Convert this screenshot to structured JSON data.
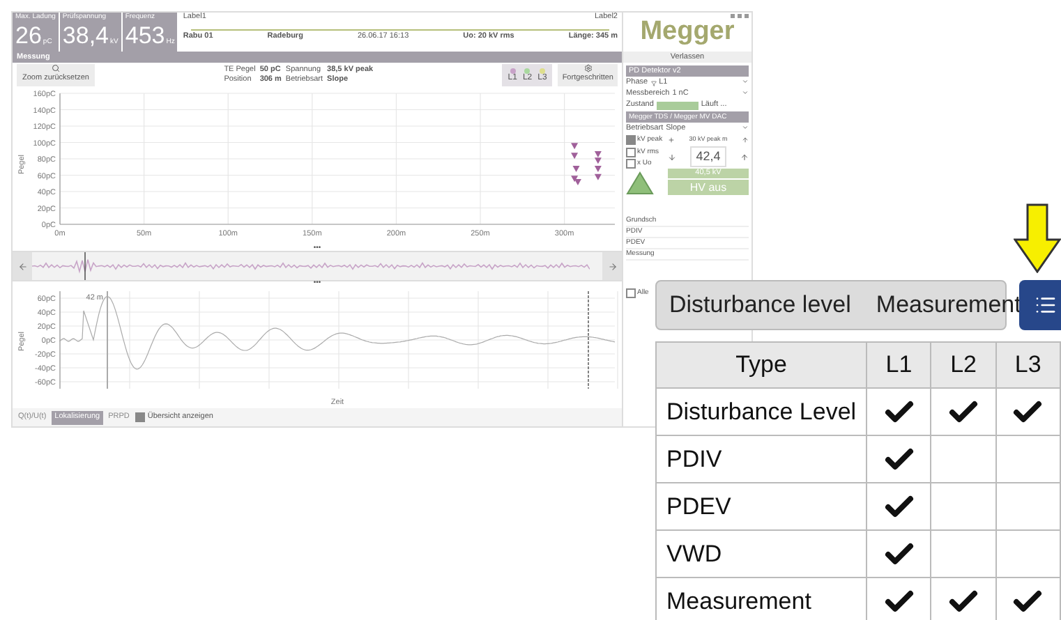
{
  "header": {
    "stats": [
      {
        "label": "Max. Ladung",
        "value": "26",
        "unit": "pC"
      },
      {
        "label": "Prüfspannung",
        "value": "38,4",
        "unit": "kV"
      },
      {
        "label": "Frequenz",
        "value": "453",
        "unit": "Hz"
      }
    ],
    "cable": {
      "label_left": "Label1",
      "label_right": "Label2",
      "start": "Rabu 01",
      "location": "Radeburg",
      "date": "26.06.17 16:13",
      "voltage": "Uo: 20 kV rms",
      "length": "Länge: 345 m"
    },
    "logo": "Megger",
    "exit_button": "Verlassen"
  },
  "section_title": "Messung",
  "toolbar": {
    "zoom_button": "Zoom zurücksetzen",
    "info": [
      {
        "label": "TE Pegel",
        "value": "50 pC"
      },
      {
        "label": "Spannung",
        "value": "38,5 kV peak"
      },
      {
        "label": "Position",
        "value": "306 m"
      },
      {
        "label": "Betriebsart",
        "value": "Slope"
      }
    ],
    "phases": [
      {
        "label": "L1",
        "color": "#c8a2c8"
      },
      {
        "label": "L2",
        "color": "#a9d89f"
      },
      {
        "label": "L3",
        "color": "#dede8c"
      }
    ],
    "advanced_button": "Fortgeschritten"
  },
  "location_chart": {
    "chart_data": {
      "type": "scatter",
      "grid": true,
      "ylabel": "Pegel",
      "xlim": [
        0,
        330
      ],
      "ylim": [
        0,
        160
      ],
      "xticks": [
        {
          "value": 0,
          "label": "0m"
        },
        {
          "value": 50,
          "label": "50m"
        },
        {
          "value": 100,
          "label": "100m"
        },
        {
          "value": 150,
          "label": "150m"
        },
        {
          "value": 200,
          "label": "200m"
        },
        {
          "value": 250,
          "label": "250m"
        },
        {
          "value": 300,
          "label": "300m"
        }
      ],
      "yticks": [
        {
          "value": 0,
          "label": "0pC"
        },
        {
          "value": 20,
          "label": "20pC"
        },
        {
          "value": 40,
          "label": "40pC"
        },
        {
          "value": 60,
          "label": "60pC"
        },
        {
          "value": 80,
          "label": "80pC"
        },
        {
          "value": 100,
          "label": "100pC"
        },
        {
          "value": 120,
          "label": "120pC"
        },
        {
          "value": 140,
          "label": "140pC"
        },
        {
          "value": 160,
          "label": "160pC"
        }
      ],
      "x": [
        306,
        306,
        307,
        306,
        308,
        320,
        320,
        320,
        320
      ],
      "series": [
        {
          "color": "#a0609a",
          "values": [
            96,
            84,
            68,
            56,
            52,
            86,
            78,
            68,
            58
          ]
        }
      ]
    }
  },
  "splitter_handles": [
    "•••",
    "•••"
  ],
  "time_chart": {
    "marker": "42 m",
    "ylabel": "Pegel",
    "xlabel": "Zeit",
    "yticks": [
      "60pC",
      "40pC",
      "20pC",
      "0pC",
      "-20pC",
      "-40pC",
      "-60pC"
    ]
  },
  "bottom_tabs": [
    {
      "label": "Q(t)/U(t)",
      "selected": false
    },
    {
      "label": "Lokalisierung",
      "selected": true
    },
    {
      "label": "PRPD",
      "selected": false
    }
  ],
  "overview_checkbox": {
    "label": "Übersicht anzeigen",
    "checked": true
  },
  "side_panel": {
    "detector": {
      "title": "PD Detektor v2",
      "phase_label": "Phase",
      "phase": "L1",
      "range_label": "Messbereich",
      "range": "1 nC",
      "state_label": "Zustand",
      "state": "Läuft ..."
    },
    "source": {
      "title": "Megger TDS / Megger MV DAC",
      "mode_label": "Betriebsart",
      "mode": "Slope",
      "setpoint": "30 kV peak m",
      "units": [
        {
          "label": "kV peak",
          "checked": true
        },
        {
          "label": "kV rms",
          "checked": false
        },
        {
          "label": "x Uo",
          "checked": false
        }
      ],
      "value": "42,4",
      "reading": "40,5 kV",
      "hv_button": "HV aus"
    },
    "list": [
      "Grundsch",
      "PDIV",
      "PDEV",
      "Messung"
    ],
    "all_checkbox": {
      "label": "Alle",
      "checked": false
    }
  },
  "callout": {
    "tabs": [
      "Disturbance level",
      "Measurement"
    ],
    "table": {
      "columns": [
        "Type",
        "L1",
        "L2",
        "L3"
      ],
      "rows": [
        {
          "type": "Disturbance Level",
          "checks": [
            true,
            true,
            true
          ]
        },
        {
          "type": "PDIV",
          "checks": [
            true,
            false,
            false
          ]
        },
        {
          "type": "PDEV",
          "checks": [
            true,
            false,
            false
          ]
        },
        {
          "type": "VWD",
          "checks": [
            true,
            false,
            false
          ]
        },
        {
          "type": "Measurement",
          "checks": [
            true,
            true,
            true
          ]
        }
      ]
    }
  }
}
